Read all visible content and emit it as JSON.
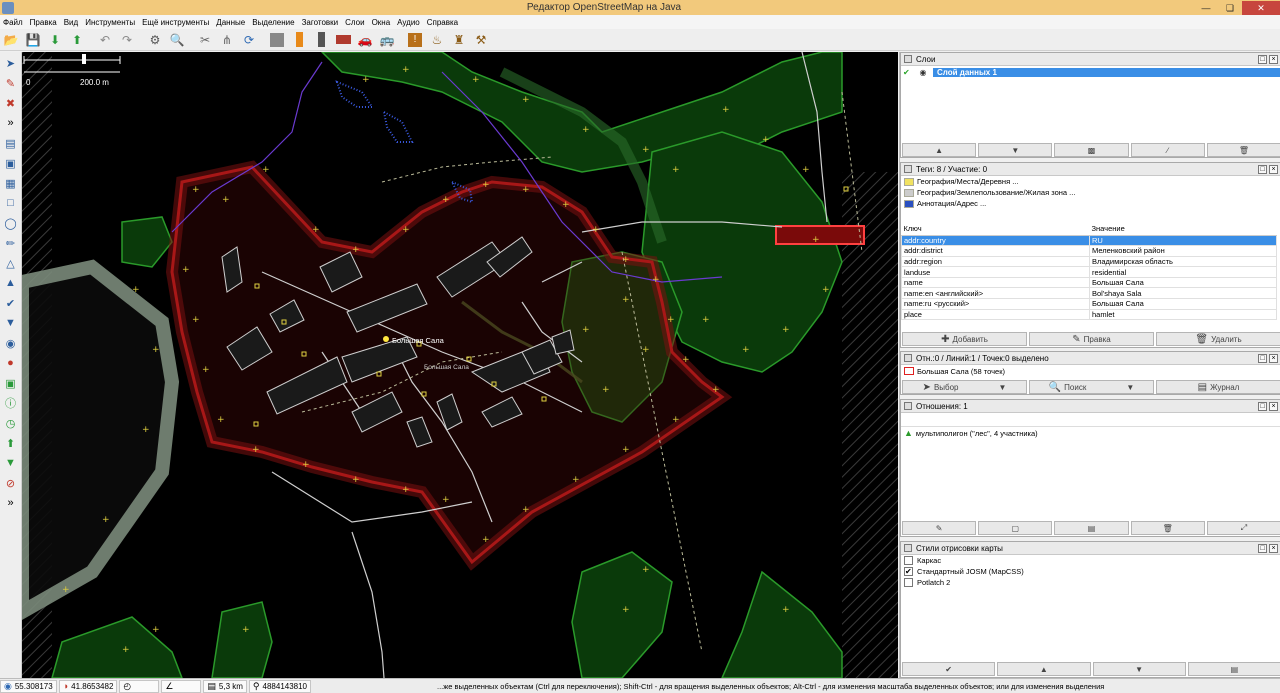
{
  "window": {
    "title": "Редактор OpenStreetMap на Java"
  },
  "menu": [
    "Файл",
    "Правка",
    "Вид",
    "Инструменты",
    "Ещё инструменты",
    "Данные",
    "Выделение",
    "Заготовки",
    "Слои",
    "Окна",
    "Аудио",
    "Справка"
  ],
  "toolbar_icons": [
    "open-file-icon",
    "save-icon",
    "download-icon",
    "upload-icon",
    "undo-icon",
    "redo-icon",
    "preferences-icon",
    "search-icon",
    "split-way-icon",
    "combine-way-icon",
    "reload-icon",
    "preset-building-icon",
    "preset-traffic-light-icon",
    "preset-street-lamp-icon",
    "preset-brick-wall-icon",
    "preset-car-icon",
    "preset-bus-icon",
    "preset-warning-icon",
    "preset-restaurant-icon",
    "preset-castle-icon",
    "preset-factory-icon"
  ],
  "left_tools": [
    "select-tool-icon",
    "draw-tool-icon",
    "delete-tool-icon",
    "more-icon",
    "layer-icon",
    "tag-icon",
    "align-icon",
    "orthogonalize-icon",
    "circle-icon",
    "pen-icon",
    "triangle-icon",
    "bookmark-icon",
    "check-icon",
    "merge-icon",
    "globe-icon",
    "pin-icon",
    "image-icon",
    "info-icon",
    "history-icon",
    "upload-icon",
    "filter-icon",
    "error-icon",
    "more-icon"
  ],
  "map": {
    "scale_zero": "0",
    "scale_label": "200.0 m",
    "place_label_main": "Большая Сала",
    "place_label_small": "Большая Сала"
  },
  "layers": {
    "title": "Слои",
    "items": [
      {
        "name": "Слой данных 1",
        "active": true
      }
    ],
    "buttons": [
      "up-icon",
      "down-icon",
      "merge-icon",
      "duplicate-icon",
      "delete-icon"
    ]
  },
  "tags": {
    "title": "Теги: 8 / Участие: 0",
    "presets": [
      "География/Места/Деревня ...",
      "География/Землепользование/Жилая зона ...",
      "Аннотация/Адрес ..."
    ],
    "col_key": "Ключ",
    "col_value": "Значение",
    "rows": [
      {
        "key": "addr:country",
        "value": "RU",
        "selected": true
      },
      {
        "key": "addr:district",
        "value": "Меленковский район"
      },
      {
        "key": "addr:region",
        "value": "Владимирская область"
      },
      {
        "key": "landuse",
        "value": "residential"
      },
      {
        "key": "name",
        "value": "Большая Сала"
      },
      {
        "key": "name:en <английский>",
        "value": "Bol'shaya Sala"
      },
      {
        "key": "name:ru <русский>",
        "value": "Большая Сала"
      },
      {
        "key": "place",
        "value": "hamlet"
      }
    ],
    "add_label": "Добавить",
    "edit_label": "Правка",
    "delete_label": "Удалить"
  },
  "selection": {
    "title": "Отн.:0 / Линий:1 / Точек:0 выделено",
    "item": "Большая Сала (58 точек)",
    "select_label": "Выбор",
    "search_label": "Поиск",
    "history_label": "Журнал"
  },
  "relations": {
    "title": "Отношения: 1",
    "item": "мультиполигон (\"лес\", 4 участника)"
  },
  "styles": {
    "title": "Стили отрисовки карты",
    "items": [
      {
        "name": "Каркас",
        "checked": false
      },
      {
        "name": "Стандартный JOSM (MapCSS)",
        "checked": true
      },
      {
        "name": "Potlatch 2",
        "checked": false
      }
    ]
  },
  "status": {
    "lat": "55.308173",
    "lon": "41.8653482",
    "angle": "",
    "heading": "",
    "distance": "5,3 km",
    "id": "4884143810",
    "help": "...же выделенных объектам (Ctrl для переключения); Shift-Ctrl - для вращения выделенных объектов; Alt-Ctrl - для изменения масштаба выделенных объектов; или для изменения выделения"
  }
}
